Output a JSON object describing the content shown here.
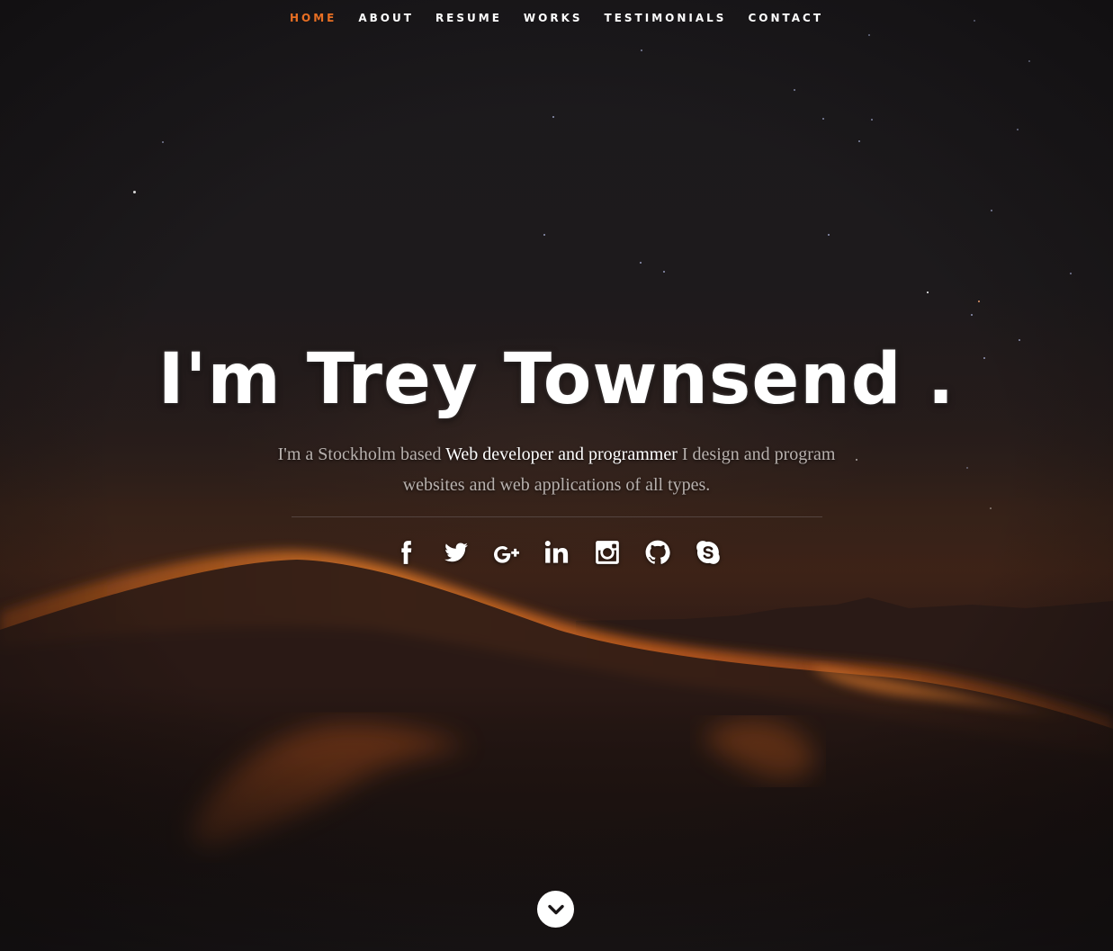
{
  "nav": {
    "items": [
      {
        "label": "HOME",
        "active": true
      },
      {
        "label": "ABOUT",
        "active": false
      },
      {
        "label": "RESUME",
        "active": false
      },
      {
        "label": "WORKS",
        "active": false
      },
      {
        "label": "TESTIMONIALS",
        "active": false
      },
      {
        "label": "CONTACT",
        "active": false
      }
    ],
    "active_color": "#e86f23"
  },
  "banner": {
    "headline": "I'm Trey Townsend .",
    "intro_prefix": "I'm a Stockholm based",
    "intro_highlight": "Web developer and programmer",
    "intro_suffix": "I design and program websites and web applications of all types."
  },
  "social": {
    "icons": [
      "facebook-icon",
      "twitter-icon",
      "google-plus-icon",
      "linkedin-icon",
      "instagram-icon",
      "github-icon",
      "skype-icon"
    ]
  },
  "scroll_down": {
    "icon": "chevron-down-icon"
  }
}
